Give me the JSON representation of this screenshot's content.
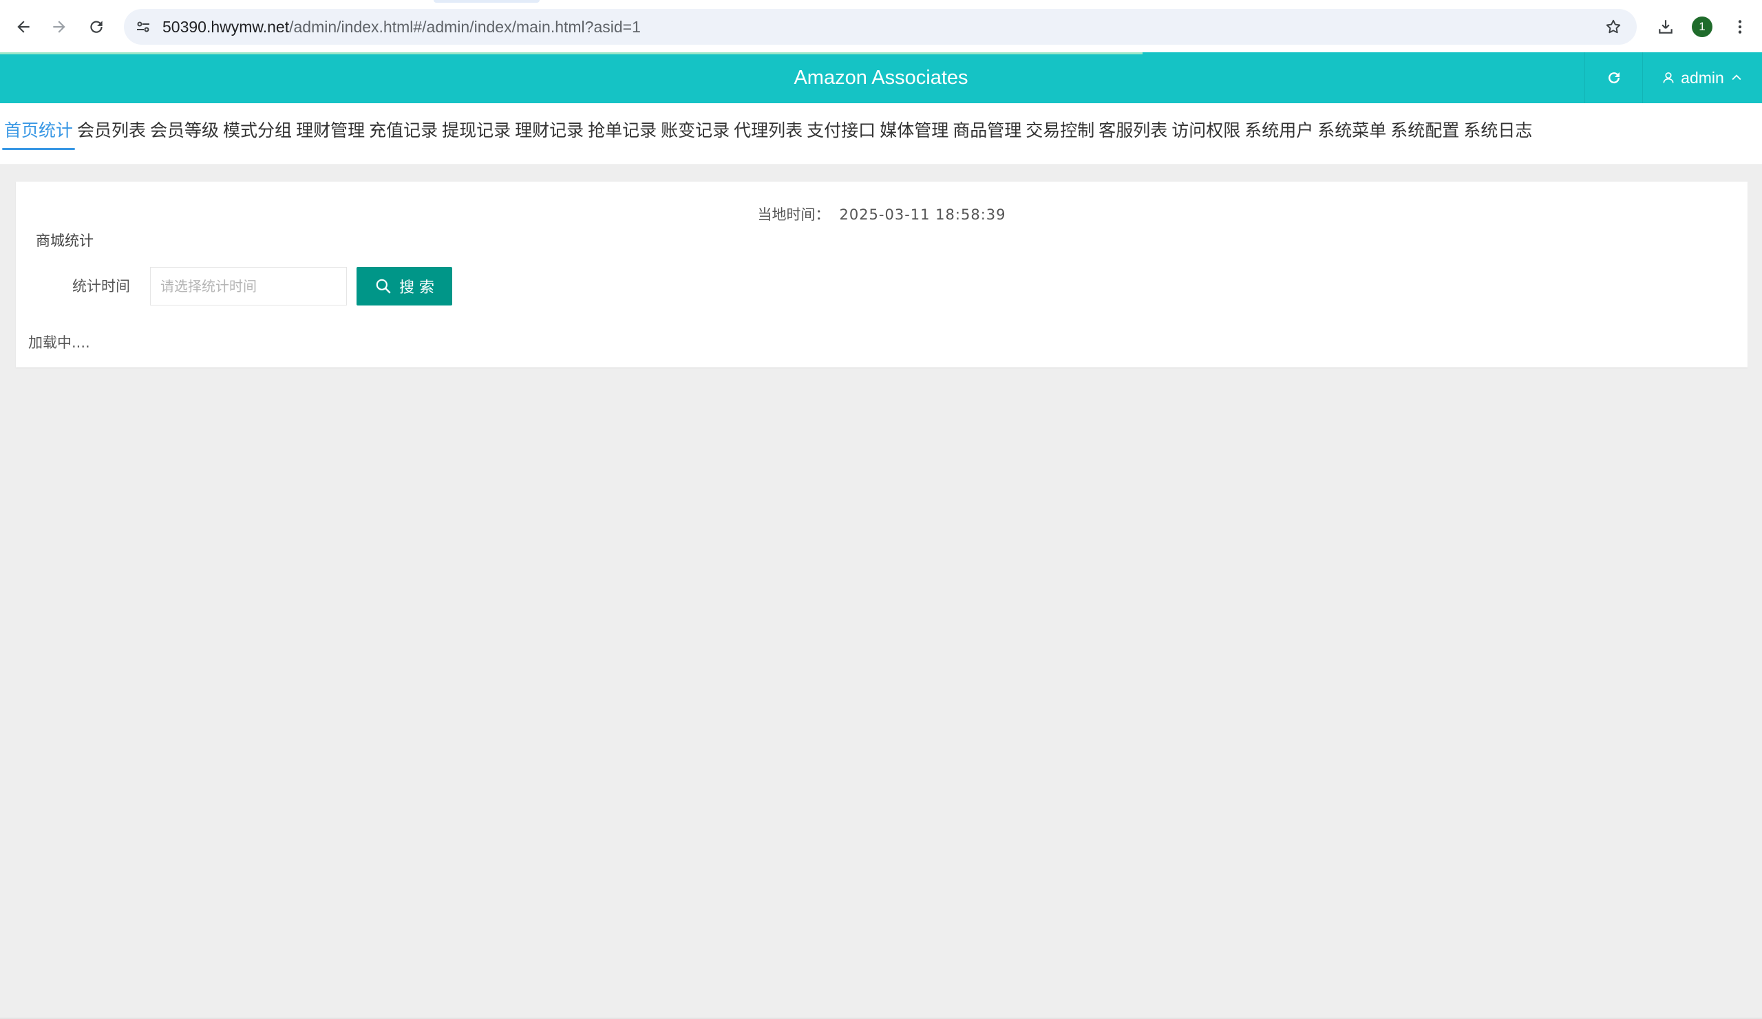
{
  "browser": {
    "url_host": "50390.hwymw.net",
    "url_path": "/admin/index.html#/admin/index/main.html?asid=1",
    "profile_initial": "1"
  },
  "header": {
    "title": "Amazon Associates",
    "user_name": "admin",
    "accent_color": "#15c3c5"
  },
  "tabs": [
    {
      "label": "首页统计",
      "active": true
    },
    {
      "label": "会员列表"
    },
    {
      "label": "会员等级"
    },
    {
      "label": "模式分组"
    },
    {
      "label": "理财管理"
    },
    {
      "label": "充值记录"
    },
    {
      "label": "提现记录"
    },
    {
      "label": "理财记录"
    },
    {
      "label": "抢单记录"
    },
    {
      "label": "账变记录"
    },
    {
      "label": "代理列表"
    },
    {
      "label": "支付接口"
    },
    {
      "label": "媒体管理"
    },
    {
      "label": "商品管理"
    },
    {
      "label": "交易控制"
    },
    {
      "label": "客服列表"
    },
    {
      "label": "访问权限"
    },
    {
      "label": "系统用户"
    },
    {
      "label": "系统菜单"
    },
    {
      "label": "系统配置"
    },
    {
      "label": "系统日志"
    }
  ],
  "main": {
    "local_time_label": "当地时间：",
    "local_time_value": "2025-03-11 18:58:39",
    "card_title": "商城统计",
    "filter_label": "统计时间",
    "filter_placeholder": "请选择统计时间",
    "search_label": "搜 索",
    "loading_text": "加载中....",
    "button_color": "#009688"
  }
}
